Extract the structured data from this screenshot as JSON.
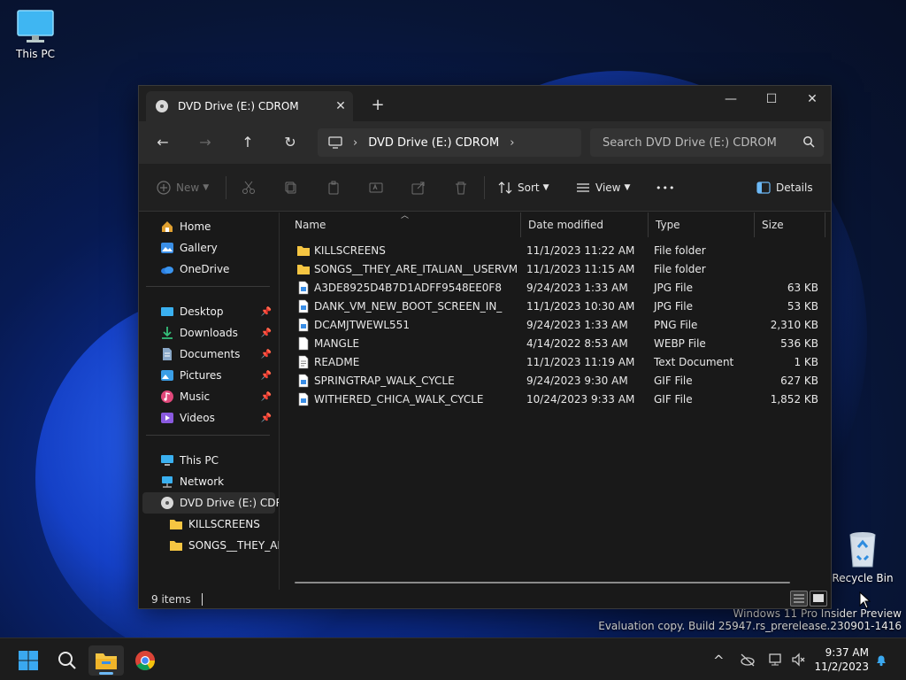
{
  "desktop": {
    "icons": [
      {
        "label": "This PC"
      },
      {
        "label": "Recycle Bin"
      }
    ],
    "watermark": {
      "line1": "Windows 11 Pro Insider Preview",
      "line2": "Evaluation copy. Build 25947.rs_prerelease.230901-1416"
    }
  },
  "window": {
    "tab_title": "DVD Drive (E:) CDROM",
    "tab_close": "✕",
    "new_tab": "+",
    "controls": {
      "minimize": "—",
      "maximize": "☐",
      "close": "✕"
    },
    "nav": {
      "back": "←",
      "forward": "→",
      "up": "↑",
      "refresh": "↻"
    },
    "address": {
      "sep1": "›",
      "crumb": "DVD Drive (E:) CDROM",
      "sep2": "›"
    },
    "search": {
      "placeholder": "Search DVD Drive (E:) CDROM"
    },
    "toolbar": {
      "new_label": "New",
      "sort_label": "Sort",
      "view_label": "View",
      "more_label": "•••",
      "details_label": "Details"
    },
    "sidebar": {
      "items": [
        {
          "label": "Home"
        },
        {
          "label": "Gallery"
        },
        {
          "label": "OneDrive"
        },
        {
          "label": "Desktop"
        },
        {
          "label": "Downloads"
        },
        {
          "label": "Documents"
        },
        {
          "label": "Pictures"
        },
        {
          "label": "Music"
        },
        {
          "label": "Videos"
        },
        {
          "label": "This PC"
        },
        {
          "label": "Network"
        },
        {
          "label": "DVD Drive (E:) CDRO"
        },
        {
          "label": "KILLSCREENS"
        },
        {
          "label": "SONGS__THEY_ARE"
        }
      ]
    },
    "columns": {
      "name": "Name",
      "date": "Date modified",
      "type": "Type",
      "size": "Size"
    },
    "files": [
      {
        "name": "KILLSCREENS",
        "date": "11/1/2023 11:22 AM",
        "type": "File folder",
        "size": "",
        "icon": "folder-icon"
      },
      {
        "name": "SONGS__THEY_ARE_ITALIAN__USERVM",
        "date": "11/1/2023 11:15 AM",
        "type": "File folder",
        "size": "",
        "icon": "folder-icon"
      },
      {
        "name": "A3DE8925D4B7D1ADFF9548EE0F8",
        "date": "9/24/2023 1:33 AM",
        "type": "JPG File",
        "size": "63 KB",
        "icon": "image-file-icon"
      },
      {
        "name": "DANK_VM_NEW_BOOT_SCREEN_IN_",
        "date": "11/1/2023 10:30 AM",
        "type": "JPG File",
        "size": "53 KB",
        "icon": "image-file-icon"
      },
      {
        "name": "DCAMJTWEWL551",
        "date": "9/24/2023 1:33 AM",
        "type": "PNG File",
        "size": "2,310 KB",
        "icon": "image-file-icon"
      },
      {
        "name": "MANGLE",
        "date": "4/14/2022 8:53 AM",
        "type": "WEBP File",
        "size": "536 KB",
        "icon": "file-icon"
      },
      {
        "name": "README",
        "date": "11/1/2023 11:19 AM",
        "type": "Text Document",
        "size": "1 KB",
        "icon": "text-file-icon"
      },
      {
        "name": "SPRINGTRAP_WALK_CYCLE",
        "date": "9/24/2023 9:30 AM",
        "type": "GIF File",
        "size": "627 KB",
        "icon": "image-file-icon"
      },
      {
        "name": "WITHERED_CHICA_WALK_CYCLE",
        "date": "10/24/2023 9:33 AM",
        "type": "GIF File",
        "size": "1,852 KB",
        "icon": "image-file-icon"
      }
    ],
    "status": {
      "item_count": "9 items"
    }
  },
  "taskbar": {
    "clock": {
      "time": "9:37 AM",
      "date": "11/2/2023"
    },
    "tray_chevron": "^"
  },
  "colors": {
    "accent": "#6cb8f5",
    "folder": "#f5c542",
    "window_bg": "#191919"
  }
}
